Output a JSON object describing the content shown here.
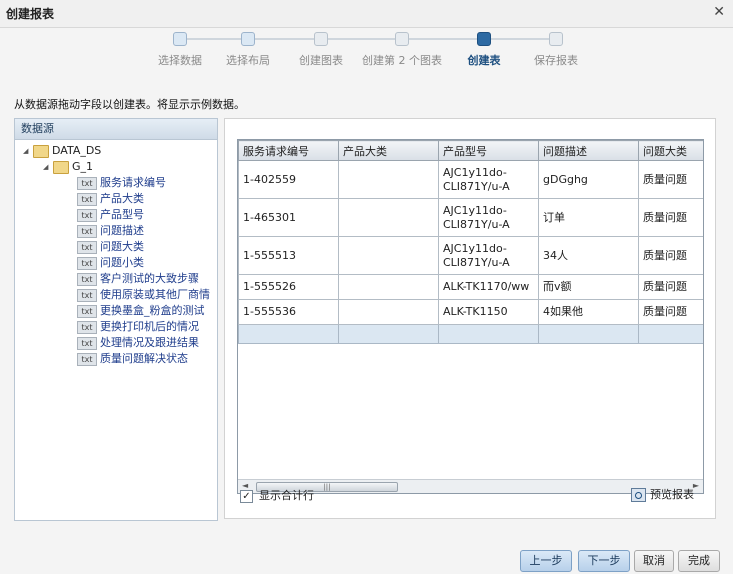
{
  "window": {
    "title": "创建报表",
    "close_glyph": "✕"
  },
  "wizard": {
    "steps": [
      {
        "label": "选择数据"
      },
      {
        "label": "选择布局"
      },
      {
        "label": "创建图表"
      },
      {
        "label": "创建第 2 个图表"
      },
      {
        "label": "创建表"
      },
      {
        "label": "保存报表"
      }
    ],
    "current_step": 5
  },
  "instructions": "从数据源拖动字段以创建表。将显示示例数据。",
  "datasource": {
    "header": "数据源",
    "root": "DATA_DS",
    "group": "G_1",
    "field_badge": "txt",
    "fields": [
      "服务请求编号",
      "产品大类",
      "产品型号",
      "问题描述",
      "问题大类",
      "问题小类",
      "客户测试的大致步骤",
      "使用原装或其他厂商情",
      "更换墨盒_粉盒的测试",
      "更换打印机后的情况",
      "处理情况及跟进结果",
      "质量问题解决状态"
    ]
  },
  "table": {
    "columns": [
      "服务请求编号",
      "产品大类",
      "产品型号",
      "问题描述",
      "问题大类"
    ],
    "rows": [
      [
        "1-402559",
        "",
        "AJC1y11do-\nCLI871Y/u-A",
        "gDGghg",
        "质量问题"
      ],
      [
        "1-465301",
        "",
        "AJC1y11do-\nCLI871Y/u-A",
        "订单",
        "质量问题"
      ],
      [
        "1-555513",
        "",
        "AJC1y11do-\nCLI871Y/u-A",
        "34人",
        "质量问题"
      ],
      [
        "1-555526",
        "",
        "ALK-TK1170/ww",
        "而v额",
        "质量问题"
      ],
      [
        "1-555536",
        "",
        "ALK-TK1150",
        "4如果他",
        "质量问题"
      ]
    ],
    "scroll_left": "◄",
    "scroll_right": "►",
    "scroll_grip": "|||"
  },
  "options": {
    "show_totals_label": "显示合计行",
    "show_totals_checked": true,
    "check_glyph": "✓"
  },
  "preview_label": "预览报表",
  "buttons": {
    "back": "上一步",
    "next": "下一步",
    "cancel": "取消",
    "finish": "完成"
  }
}
